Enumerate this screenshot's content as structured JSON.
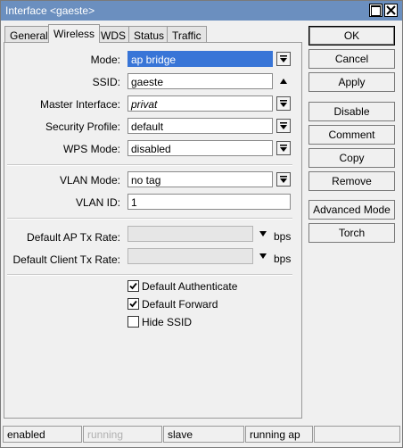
{
  "window": {
    "title": "Interface <gaeste>"
  },
  "tabs": [
    {
      "label": "General",
      "active": false
    },
    {
      "label": "Wireless",
      "active": true
    },
    {
      "label": "WDS",
      "active": false
    },
    {
      "label": "Status",
      "active": false
    },
    {
      "label": "Traffic",
      "active": false
    }
  ],
  "form": {
    "mode": {
      "label": "Mode:",
      "value": "ap bridge"
    },
    "ssid": {
      "label": "SSID:",
      "value": "gaeste"
    },
    "master_interface": {
      "label": "Master Interface:",
      "value": "privat"
    },
    "security_profile": {
      "label": "Security Profile:",
      "value": "default"
    },
    "wps_mode": {
      "label": "WPS Mode:",
      "value": "disabled"
    },
    "vlan_mode": {
      "label": "VLAN Mode:",
      "value": "no tag"
    },
    "vlan_id": {
      "label": "VLAN ID:",
      "value": "1"
    },
    "default_ap_tx_rate": {
      "label": "Default AP Tx Rate:",
      "value": "",
      "unit": "bps"
    },
    "default_client_tx_rate": {
      "label": "Default Client Tx Rate:",
      "value": "",
      "unit": "bps"
    }
  },
  "checkboxes": {
    "default_authenticate": {
      "label": "Default Authenticate",
      "checked": true
    },
    "default_forward": {
      "label": "Default Forward",
      "checked": true
    },
    "hide_ssid": {
      "label": "Hide SSID",
      "checked": false
    }
  },
  "buttons": {
    "ok": "OK",
    "cancel": "Cancel",
    "apply": "Apply",
    "disable": "Disable",
    "comment": "Comment",
    "copy": "Copy",
    "remove": "Remove",
    "advanced_mode": "Advanced Mode",
    "torch": "Torch"
  },
  "statusbar": {
    "enabled": "enabled",
    "running": "running",
    "slave": "slave",
    "running_ap": "running ap"
  },
  "colors": {
    "titlebar": "#6b8fbf",
    "selection": "#3875d7",
    "window_bg": "#f0f0f0"
  }
}
